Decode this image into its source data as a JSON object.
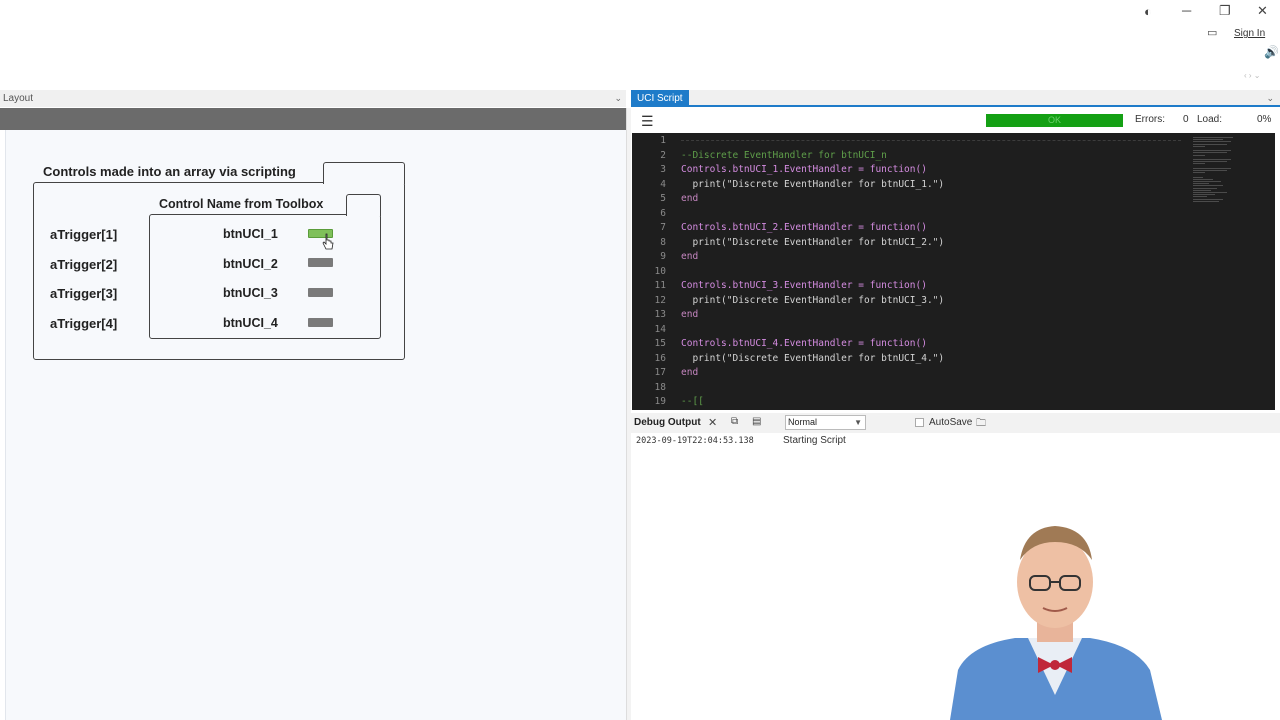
{
  "titlebar": {
    "sign_in": "Sign In"
  },
  "layout_pane": {
    "header": "Layout",
    "outer_group_title": "Controls made into an array via scripting",
    "inner_group_title": "Control Name from Toolbox",
    "rows": [
      {
        "array_name": "aTrigger[1]",
        "control_name": "btnUCI_1",
        "active": true
      },
      {
        "array_name": "aTrigger[2]",
        "control_name": "btnUCI_2",
        "active": false
      },
      {
        "array_name": "aTrigger[3]",
        "control_name": "btnUCI_3",
        "active": false
      },
      {
        "array_name": "aTrigger[4]",
        "control_name": "btnUCI_4",
        "active": false
      }
    ]
  },
  "script_pane": {
    "tab": "UCI Script",
    "status": "OK",
    "errors_label": "Errors:",
    "errors_value": "0",
    "load_label": "Load:",
    "load_value": "0%",
    "line_numbers": [
      "1",
      "2",
      "3",
      "4",
      "5",
      "6",
      "7",
      "8",
      "9",
      "10",
      "11",
      "12",
      "13",
      "14",
      "15",
      "16",
      "17",
      "18",
      "19"
    ],
    "code": [
      {
        "text": "",
        "cls": "c-cm"
      },
      {
        "text": "--Discrete EventHandler for btnUCI_n",
        "cls": "c-cm"
      },
      {
        "text": "Controls.btnUCI_1.EventHandler = function()",
        "cls": "c-id"
      },
      {
        "text": "  print(\"Discrete EventHandler for btnUCI_1.\")",
        "cls": "c-str"
      },
      {
        "text": "end",
        "cls": "c-end"
      },
      {
        "text": "",
        "cls": "c-str"
      },
      {
        "text": "Controls.btnUCI_2.EventHandler = function()",
        "cls": "c-id"
      },
      {
        "text": "  print(\"Discrete EventHandler for btnUCI_2.\")",
        "cls": "c-str"
      },
      {
        "text": "end",
        "cls": "c-end"
      },
      {
        "text": "",
        "cls": "c-str"
      },
      {
        "text": "Controls.btnUCI_3.EventHandler = function()",
        "cls": "c-id"
      },
      {
        "text": "  print(\"Discrete EventHandler for btnUCI_3.\")",
        "cls": "c-str"
      },
      {
        "text": "end",
        "cls": "c-end"
      },
      {
        "text": "",
        "cls": "c-str"
      },
      {
        "text": "Controls.btnUCI_4.EventHandler = function()",
        "cls": "c-id"
      },
      {
        "text": "  print(\"Discrete EventHandler for btnUCI_4.\")",
        "cls": "c-str"
      },
      {
        "text": "end",
        "cls": "c-end"
      },
      {
        "text": "",
        "cls": "c-str"
      },
      {
        "text": "--[[",
        "cls": "c-cm"
      }
    ]
  },
  "debug_pane": {
    "title": "Debug Output",
    "level_selected": "Normal",
    "autosave_label": "AutoSave",
    "log": [
      {
        "timestamp": "2023-09-19T22:04:53.138",
        "message": "Starting Script"
      }
    ]
  },
  "colors": {
    "accent": "#1e7bc9",
    "status_ok": "#14a014",
    "editor_bg": "#1e1e1e"
  }
}
